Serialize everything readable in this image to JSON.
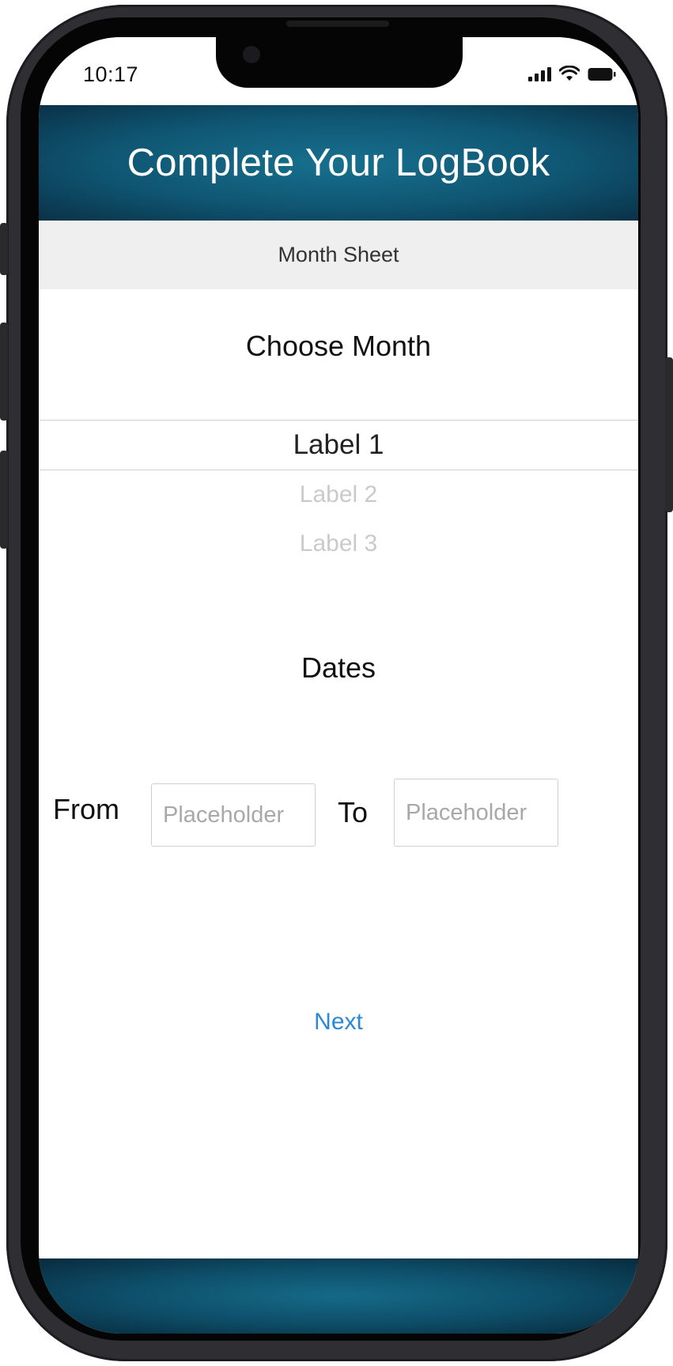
{
  "status_bar": {
    "time": "10:17",
    "icons": [
      "signal-icon",
      "wifi-icon",
      "battery-icon"
    ]
  },
  "header": {
    "title": "Complete Your LogBook"
  },
  "subheader": {
    "label": "Month Sheet"
  },
  "month_section": {
    "title": "Choose Month",
    "picker": {
      "selected": "Label 1",
      "options": [
        "Label 2",
        "Label 3"
      ]
    }
  },
  "dates_section": {
    "title": "Dates",
    "from_label": "From",
    "from_placeholder": "Placeholder",
    "to_label": "To",
    "to_placeholder": "Placeholder"
  },
  "actions": {
    "next_label": "Next"
  },
  "colors": {
    "header_teal": "#0f5673",
    "link_blue": "#2a88d6",
    "subheader_bg": "#efefef"
  }
}
